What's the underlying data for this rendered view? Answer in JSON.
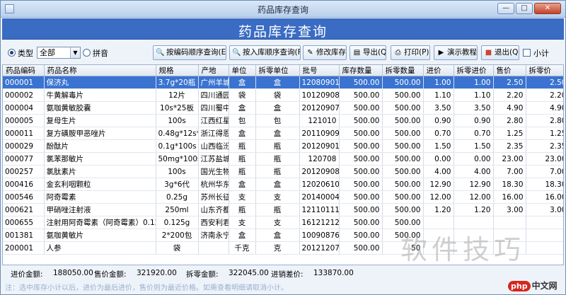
{
  "window": {
    "title": "药品库存查询",
    "min": "—",
    "max": "□",
    "close": "✕"
  },
  "banner": {
    "title": "药品库存查询"
  },
  "toolbar": {
    "radio_type": "类型",
    "select_value": "全部",
    "select_arrow": "▼",
    "radio_pinyin": "拼音",
    "btn_by_code": "按编码顺序查询(E)",
    "btn_by_stock_in": "按入库顺序查询(F)",
    "btn_edit_stock": "修改库存",
    "btn_export": "导出(Q)",
    "btn_print": "打印(P)",
    "btn_tutorial": "演示教程",
    "btn_exit": "退出(Q)",
    "checkbox_subtotal": "小计"
  },
  "table": {
    "headers": [
      "药品编码",
      "药品名称",
      "规格",
      "产地",
      "单位",
      "拆零单位",
      "批号",
      "库存数量",
      "拆零数量",
      "进价",
      "拆零进价",
      "售价",
      "拆零价"
    ],
    "rows": [
      [
        "000001",
        "保济丸",
        "3.7g*20瓶",
        "广州羊城",
        "盒",
        "盒",
        "12080901",
        "500.00",
        "500.00",
        "1.00",
        "1.00",
        "2.50",
        "2.50"
      ],
      [
        "000002",
        "牛黄解毒片",
        "12片",
        "四川通园",
        "袋",
        "袋",
        "10120908",
        "500.00",
        "500.00",
        "1.10",
        "1.10",
        "2.20",
        "2.20"
      ],
      [
        "000004",
        "氨咖黄敏胶囊",
        "10s*25板",
        "四川蜀中",
        "盒",
        "盒",
        "20120907",
        "500.00",
        "500.00",
        "3.50",
        "3.50",
        "4.90",
        "4.90"
      ],
      [
        "000005",
        "复母生片",
        "100s",
        "江西红星",
        "包",
        "包",
        "121010",
        "500.00",
        "500.00",
        "0.90",
        "0.90",
        "2.80",
        "2.80"
      ],
      [
        "000011",
        "复方磺胺甲恶唑片",
        "0.48g*12s*5板",
        "浙江得恩",
        "盒",
        "盒",
        "20110909",
        "500.00",
        "500.00",
        "0.70",
        "0.70",
        "1.25",
        "1.25"
      ],
      [
        "000029",
        "酚酞片",
        "0.1g*100s",
        "山西临汾",
        "瓶",
        "瓶",
        "2012090101",
        "500.00",
        "500.00",
        "1.50",
        "1.50",
        "2.35",
        "2.35"
      ],
      [
        "000077",
        "氯苯那敏片",
        "50mg*100s",
        "江苏盐城",
        "瓶",
        "瓶",
        "120708",
        "500.00",
        "500.00",
        "0.00",
        "0.00",
        "23.00",
        "23.00"
      ],
      [
        "000257",
        "氯肽素片",
        "100s",
        "国光生物",
        "瓶",
        "瓶",
        "201209089",
        "500.00",
        "500.00",
        "4.00",
        "4.00",
        "7.00",
        "7.00"
      ],
      [
        "000416",
        "金玄利咽颗粒",
        "3g*6代",
        "杭州华东",
        "盒",
        "盒",
        "12020610",
        "500.00",
        "500.00",
        "12.90",
        "12.90",
        "18.30",
        "18.30"
      ],
      [
        "000546",
        "阿奇霉素",
        "0.25g",
        "苏州长征",
        "支",
        "支",
        "20140004",
        "500.00",
        "500.00",
        "12.00",
        "12.00",
        "16.00",
        "16.00"
      ],
      [
        "000621",
        "甲硝唑注射液",
        "250ml",
        "山东齐都",
        "瓶",
        "瓶",
        "12110111",
        "500.00",
        "500.00",
        "1.20",
        "1.20",
        "3.00",
        "3.00"
      ],
      [
        "000655",
        "注射用阿奇霉素（阿奇霉素）0.125",
        "0.125g",
        "西安利君",
        "支",
        "支",
        "16121212",
        "500.00",
        "500.00",
        "",
        "",
        "",
        ""
      ],
      [
        "001381",
        "氨咖黄敏片",
        "2*200包",
        "济南永宁",
        "盒",
        "盒",
        "10090876",
        "500.00",
        "500.00",
        "",
        "",
        "",
        ""
      ],
      [
        "200001",
        "人参",
        "袋",
        "",
        "千克",
        "克",
        "20121207",
        "500.00",
        "50",
        "",
        "",
        "",
        ""
      ]
    ]
  },
  "footer": {
    "cost_label": "进价金额:",
    "cost_value": "188050.00",
    "sale_label": "售价金额:",
    "sale_value": "321920.00",
    "split_label": "拆零金额:",
    "split_value": "322045.00",
    "margin_label": "进销差价:",
    "margin_value": "133870.00"
  },
  "hint": "注：选中库存小计以后，进价为最后进价，售价则为最近价格。如需查看明细请取消小计。",
  "watermark": "软件技巧",
  "logo": {
    "badge": "php",
    "text": "中文网"
  }
}
